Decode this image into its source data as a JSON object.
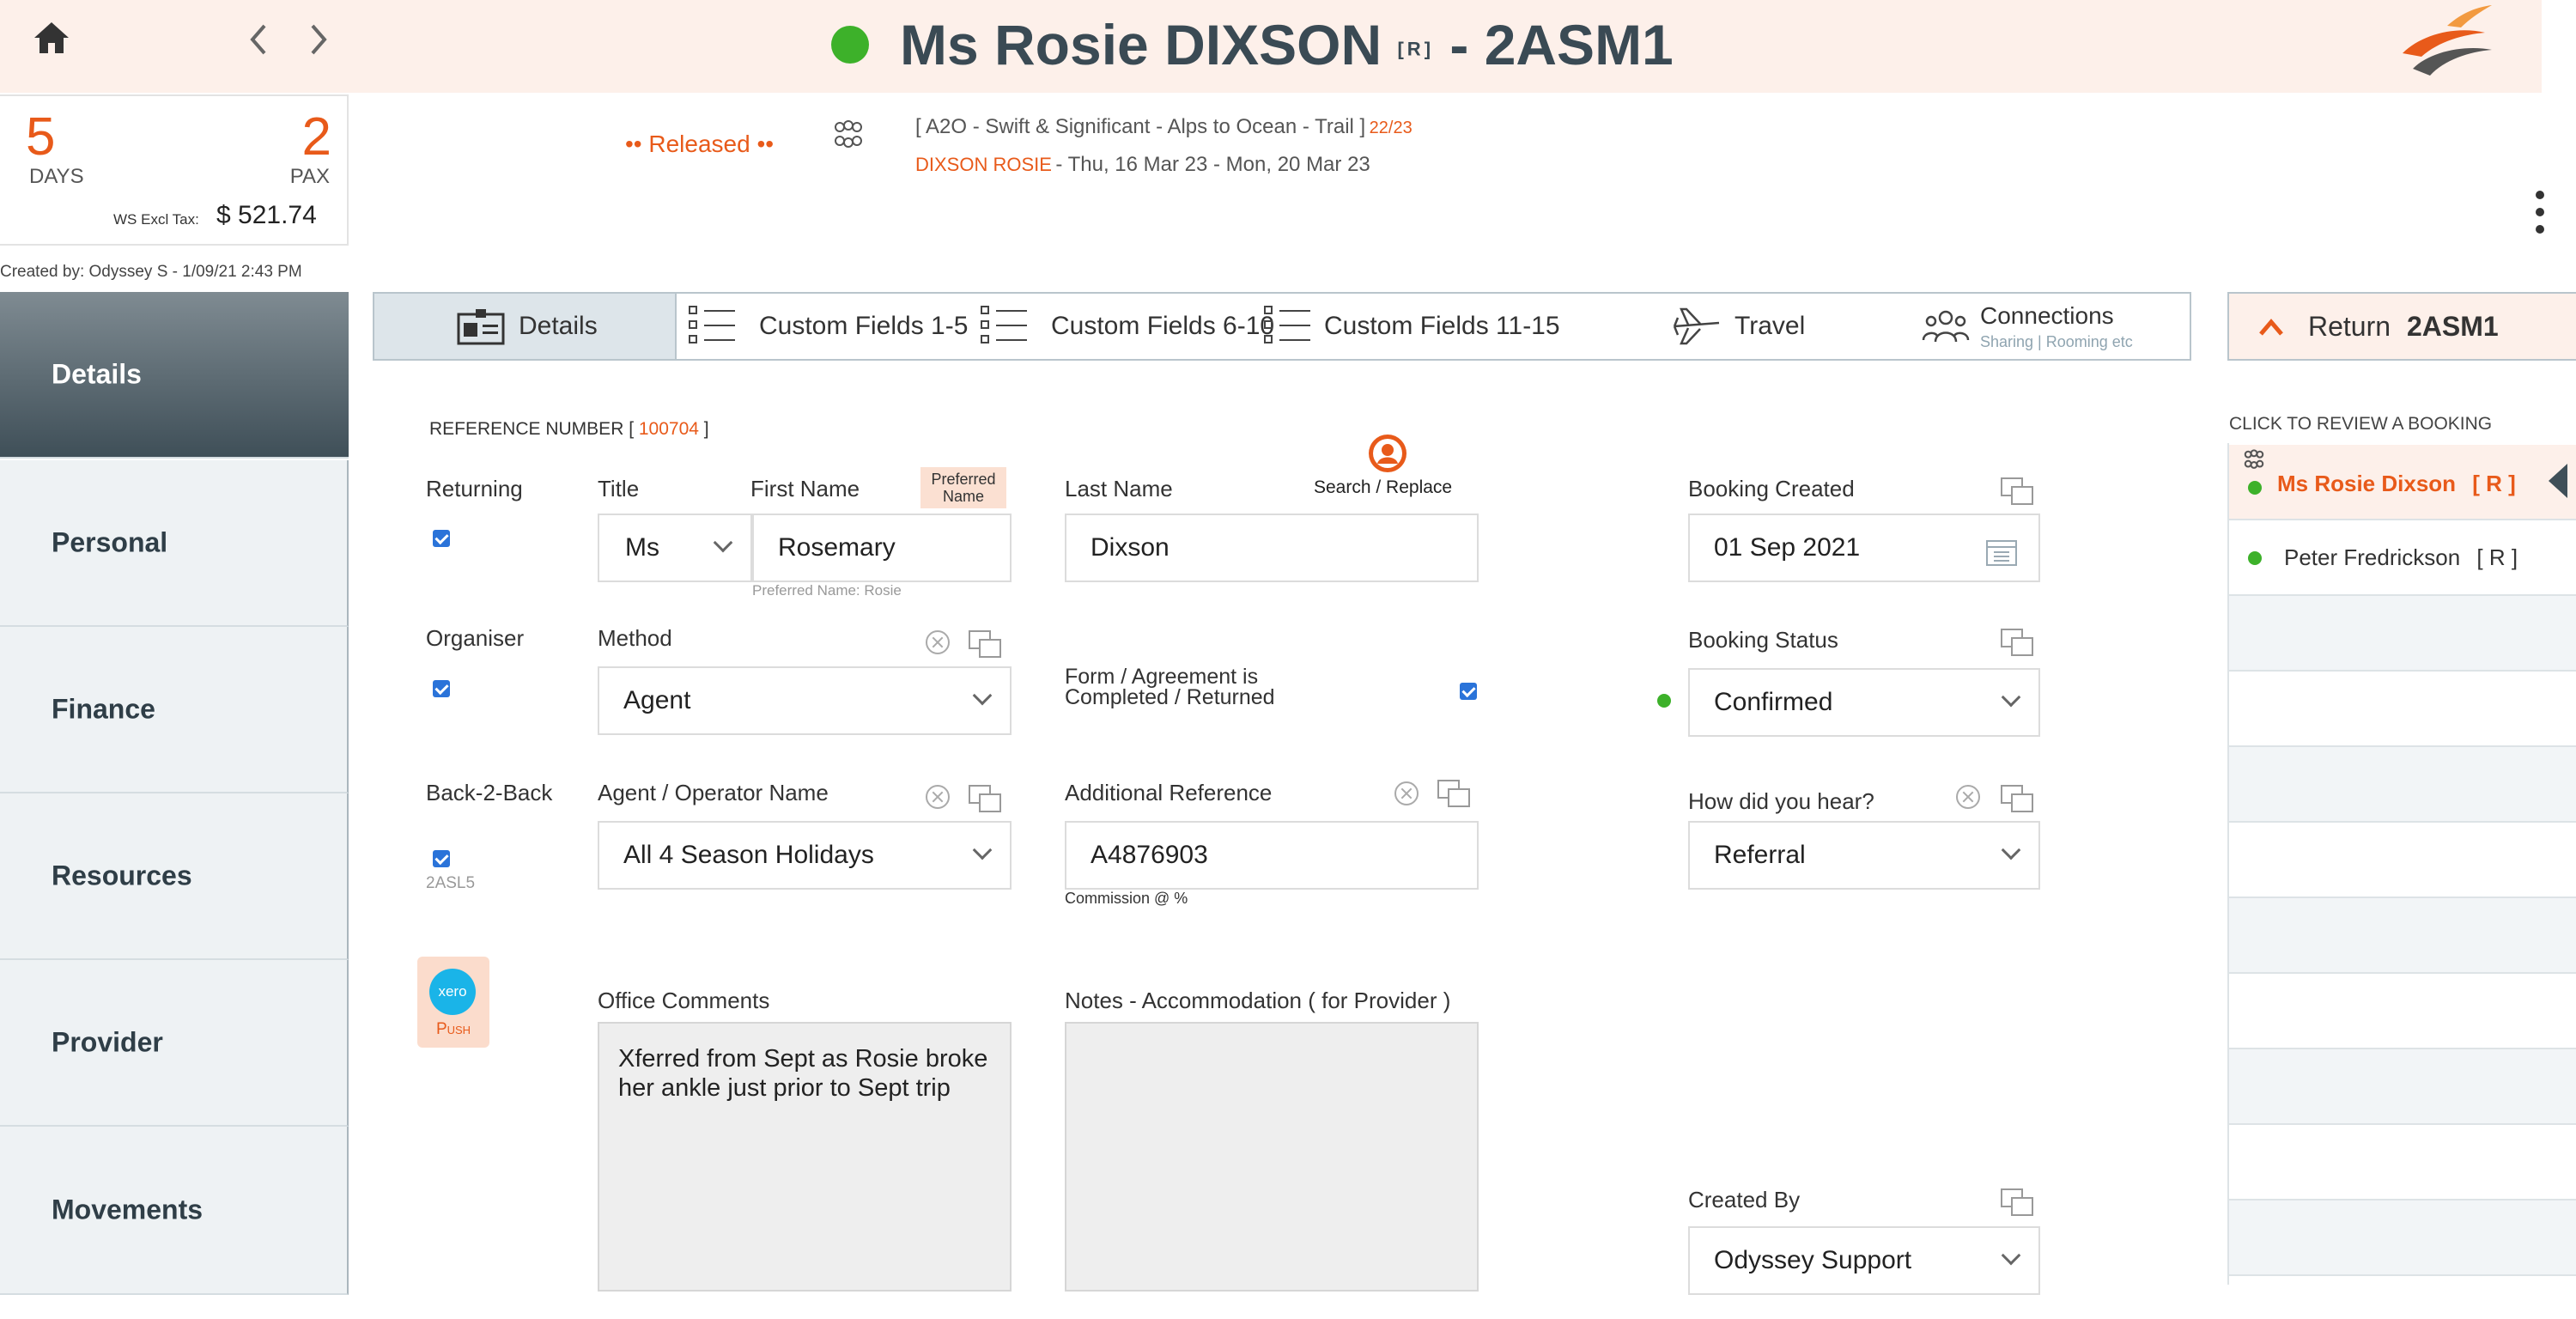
{
  "header": {
    "title": "Ms Rosie DIXSON",
    "title_tag": "[R]",
    "title_code": "- 2ASM1",
    "status_color": "#3db12a"
  },
  "summary": {
    "days_value": "5",
    "days_label": "DAYS",
    "pax_value": "2",
    "pax_label": "PAX",
    "ws_label": "WS Excl Tax:",
    "ws_value": "$ 521.74",
    "created_by": "Created by: Odyssey S - 1/09/21 2:43 PM"
  },
  "trip": {
    "status": "•• Released ••",
    "name": "[ A2O - Swift & Significant - Alps to Ocean - Trail ]",
    "season": "22/23",
    "lead_name": "DIXSON ROSIE",
    "dates": "- Thu, 16 Mar 23 - Mon, 20 Mar 23"
  },
  "sidebar": {
    "items": [
      {
        "label": "Details"
      },
      {
        "label": "Personal"
      },
      {
        "label": "Finance"
      },
      {
        "label": "Resources"
      },
      {
        "label": "Provider"
      },
      {
        "label": "Movements"
      }
    ]
  },
  "tabs": [
    {
      "label": "Details"
    },
    {
      "label": "Custom Fields 1-5"
    },
    {
      "label": "Custom Fields  6-10"
    },
    {
      "label": "Custom Fields  11-15"
    },
    {
      "label": "Travel"
    },
    {
      "label": "Connections",
      "sub": "Sharing | Rooming etc"
    }
  ],
  "return_button": {
    "label": "Return",
    "code": "2ASM1"
  },
  "form": {
    "reference_label": "REFERENCE NUMBER [",
    "reference_value": "100704",
    "reference_close": "]",
    "returning_label": "Returning",
    "title_label": "Title",
    "title_value": "Ms",
    "first_name_label": "First Name",
    "preferred_badge": "Preferred Name",
    "first_name_value": "Rosemary",
    "preferred_hint": "Preferred Name: Rosie",
    "last_name_label": "Last Name",
    "search_replace": "Search / Replace",
    "last_name_value": "Dixson",
    "booking_created_label": "Booking Created",
    "booking_created_value": "01 Sep 2021",
    "organiser_label": "Organiser",
    "method_label": "Method",
    "method_value": "Agent",
    "form_agreement_label": "Form / Agreement is Completed / Returned",
    "booking_status_label": "Booking Status",
    "booking_status_value": "Confirmed",
    "back2back_label": "Back-2-Back",
    "back2back_code": "2ASL5",
    "agent_label": "Agent / Operator Name",
    "agent_value": "All 4 Season Holidays",
    "additional_ref_label": "Additional Reference",
    "additional_ref_value": "A4876903",
    "commission_label": "Commission @  %",
    "how_hear_label": "How did you hear?",
    "how_hear_value": "Referral",
    "xero_logo": "xero",
    "push_label": "Push",
    "office_comments_label": "Office Comments",
    "office_comments_value": "Xferred from Sept as Rosie broke her ankle just prior to Sept trip",
    "notes_label": "Notes - Accommodation ( for Provider )",
    "created_by_label": "Created By",
    "created_by_value": "Odyssey Support"
  },
  "bookings": {
    "header": "CLICK TO REVIEW A BOOKING",
    "items": [
      {
        "name": "Ms Rosie Dixson",
        "tag": "[ R ]",
        "selected": true
      },
      {
        "name": "Peter Fredrickson",
        "tag": "[ R ]",
        "selected": false
      }
    ]
  },
  "colors": {
    "accent": "#e85a1a",
    "green": "#3db12a",
    "header_bg": "#fdf0ea",
    "sidebar_active": "#3f4f58"
  }
}
